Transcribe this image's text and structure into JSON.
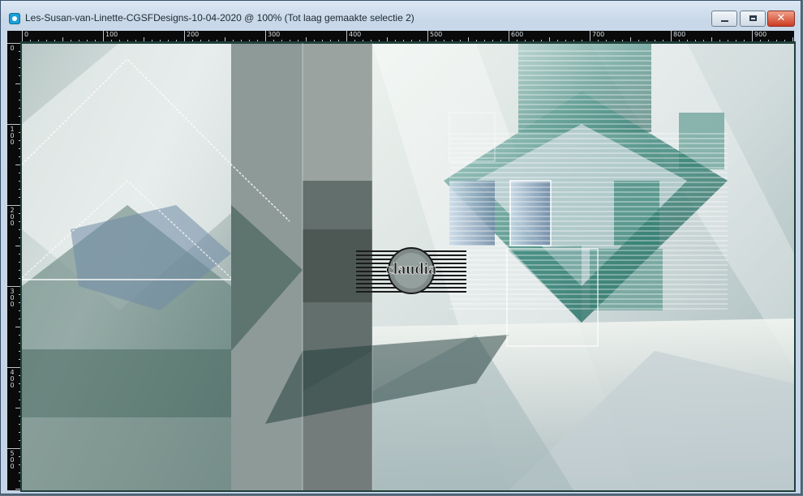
{
  "window": {
    "title": "Les-Susan-van-Linette-CGSFDesigns-10-04-2020 @ 100% (Tot laag gemaakte selectie 2)",
    "controls": [
      {
        "name": "minimize-button",
        "icon": "minimize-icon"
      },
      {
        "name": "maximize-button",
        "icon": "restore-icon"
      },
      {
        "name": "close-button",
        "icon": "close-icon"
      }
    ]
  },
  "ruler": {
    "horizontal_labels": [
      "0",
      "100",
      "200",
      "300",
      "400",
      "500",
      "600",
      "700",
      "800",
      "900"
    ],
    "vertical_labels": [
      "0",
      "100",
      "200",
      "300",
      "400",
      "500"
    ]
  },
  "canvas": {
    "watermark_text": "claudia",
    "colors": {
      "teal": "#2f7f72",
      "dark_green": "#3e5b54",
      "light_gray": "#d6dddb",
      "steel_blue": "#6f8aa6",
      "frame": "#1f3f3a"
    }
  }
}
